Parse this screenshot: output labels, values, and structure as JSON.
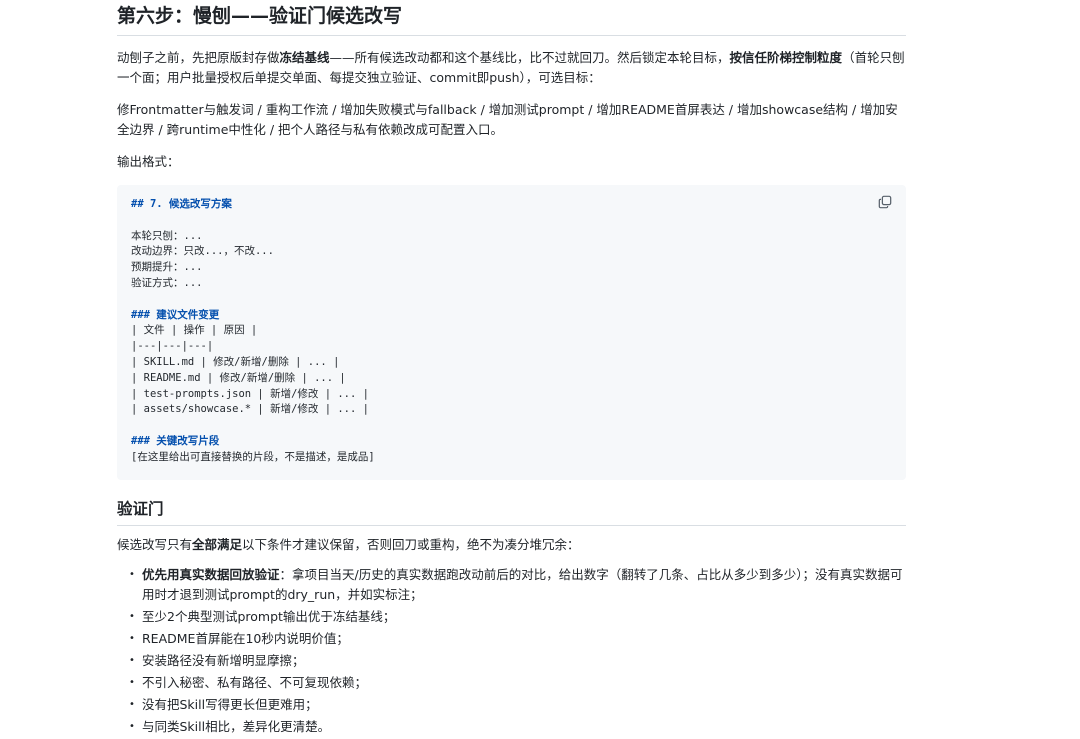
{
  "section_title": "第六步：慢刨——验证门候选改写",
  "intro": {
    "t1": "动刨子之前，先把原版封存做",
    "t1_bold": "冻结基线",
    "t2": "——所有候选改动都和这个基线比，比不过就回刀。然后锁定本轮目标，",
    "t2_bold": "按信任阶梯控制粒度",
    "t3": "（首轮只刨一个面；用户批量授权后单提交单面、每提交独立验证、commit即push），可选目标："
  },
  "targets": "修Frontmatter与触发词 / 重构工作流 / 增加失败模式与fallback / 增加测试prompt / 增加README首屏表达 / 增加showcase结构 / 增加安全边界 / 跨runtime中性化 / 把个人路径与私有依赖改成可配置入口。",
  "output_format_label": "输出格式：",
  "code_block": {
    "copy_icon": "copy-icon",
    "h7": "## 7. 候选改写方案",
    "l1": "本轮只刨：...",
    "l2": "改动边界：只改...，不改...",
    "l3": "预期提升：...",
    "l4": "验证方式：...",
    "h_files": "### 建议文件变更",
    "r1": "| 文件 | 操作 | 原因 |",
    "r2": "|---|---|---|",
    "r3": "| SKILL.md | 修改/新增/删除 | ... |",
    "r4": "| README.md | 修改/新增/删除 | ... |",
    "r5": "| test-prompts.json | 新增/修改 | ... |",
    "r6": "| assets/showcase.* | 新增/修改 | ... |",
    "h_snip": "### 关键改写片段",
    "snip": "[在这里给出可直接替换的片段，不是描述，是成品]"
  },
  "gate_title": "验证门",
  "gate_intro": {
    "t1": "候选改写只有",
    "t1_bold": "全部满足",
    "t2": "以下条件才建议保留，否则回刀或重构，绝不为凑分堆冗余："
  },
  "bullet_char": "•",
  "items": {
    "i1_bold": "优先用真实数据回放验证",
    "i1": "：拿项目当天/历史的真实数据跑改动前后的对比，给出数字（翻转了几条、占比从多少到多少）；没有真实数据可用时才退到测试prompt的dry_run，并如实标注；",
    "i2": "至少2个典型测试prompt输出优于冻结基线；",
    "i3": "README首屏能在10秒内说明价值；",
    "i4": "安装路径没有新增明显摩擦；",
    "i5": "不引入秘密、私有路径、不可复现依赖；",
    "i6": "没有把Skill写得更长但更难用；",
    "i7": "与同类Skill相比，差异化更清楚。"
  }
}
